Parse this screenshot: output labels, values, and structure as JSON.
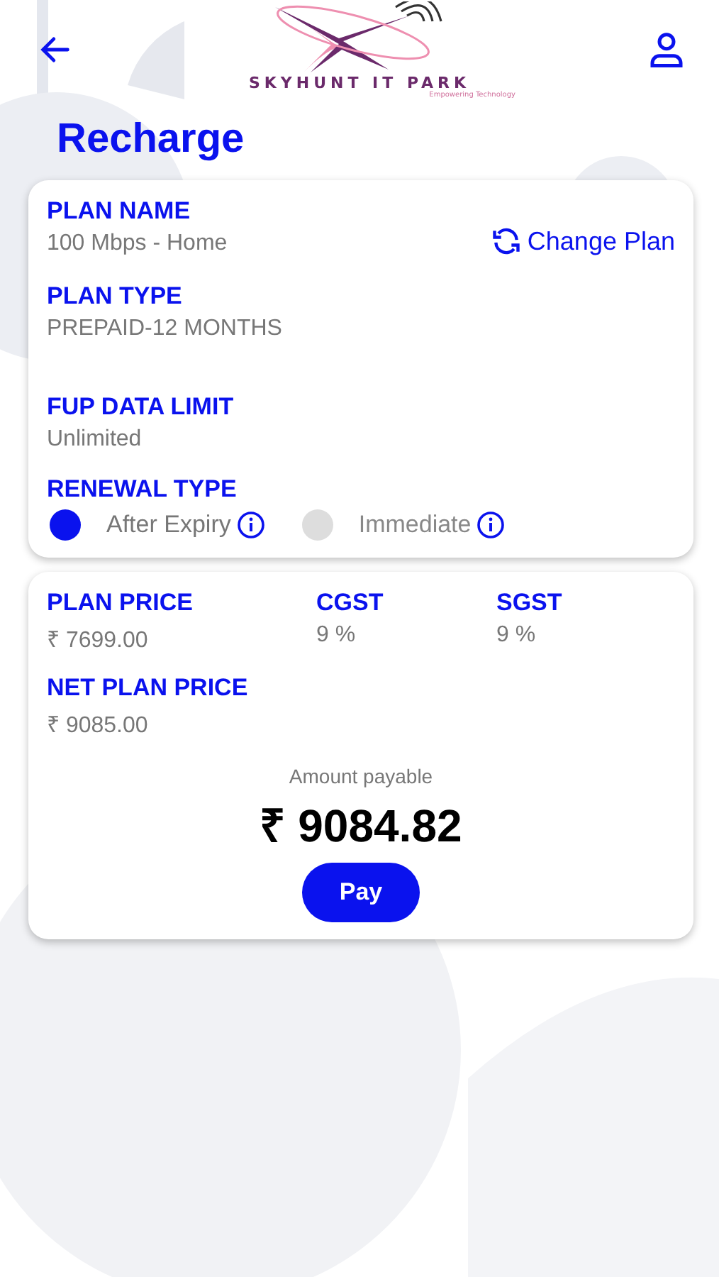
{
  "header": {
    "logo_name": "SKYHUNT IT PARK",
    "logo_tagline": "Empowering Technology"
  },
  "title": "Recharge",
  "plan": {
    "name_label": "PLAN NAME",
    "name": "100 Mbps - Home",
    "change_label": "Change Plan",
    "type_label": "PLAN TYPE",
    "type": "PREPAID-12 MONTHS",
    "fup_label": "FUP DATA LIMIT",
    "fup": "Unlimited",
    "renewal_label": "RENEWAL TYPE",
    "renewal_options": [
      {
        "label": "After Expiry",
        "selected": true
      },
      {
        "label": "Immediate",
        "selected": false
      }
    ]
  },
  "pricing": {
    "items": [
      {
        "label": "PLAN PRICE",
        "value": "₹ 7699.00"
      },
      {
        "label": "CGST",
        "value": "9 %"
      },
      {
        "label": "SGST",
        "value": "9 %"
      }
    ],
    "net_label": "NET PLAN PRICE",
    "net_value": "₹ 9085.00",
    "amount_label": "Amount payable",
    "amount": "₹ 9084.82",
    "pay_label": "Pay"
  }
}
